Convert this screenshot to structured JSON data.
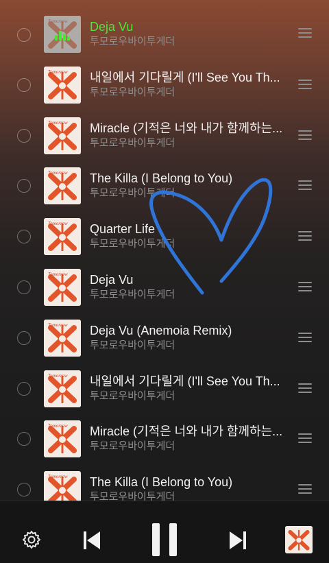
{
  "tracks": [
    {
      "title": "Deja Vu",
      "artist": "투모로우바이투게더",
      "playing": true
    },
    {
      "title": "내일에서 기다릴게 (I'll See You Th...",
      "artist": "투모로우바이투게더"
    },
    {
      "title": "Miracle (기적은 너와 내가 함께하는...",
      "artist": "투모로우바이투게더"
    },
    {
      "title": "The Killa (I Belong to You)",
      "artist": "투모로우바이투게더"
    },
    {
      "title": "Quarter Life",
      "artist": "투모로우바이투게더"
    },
    {
      "title": "Deja Vu",
      "artist": "투모로우바이투게더"
    },
    {
      "title": "Deja Vu (Anemoia Remix)",
      "artist": "투모로우바이투게더"
    },
    {
      "title": "내일에서 기다릴게 (I'll See You Th...",
      "artist": "투모로우바이투게더"
    },
    {
      "title": "Miracle (기적은 너와 내가 함께하는...",
      "artist": "투모로우바이투게더"
    },
    {
      "title": "The Killa (I Belong to You)",
      "artist": "투모로우바이투게더"
    }
  ],
  "colors": {
    "playing": "#4ce53a",
    "heart": "#2f74d6",
    "cover_red": "#e2552a"
  },
  "player": {
    "state": "playing",
    "icons": [
      "gear-icon",
      "previous-icon",
      "pause-icon",
      "next-icon"
    ]
  }
}
